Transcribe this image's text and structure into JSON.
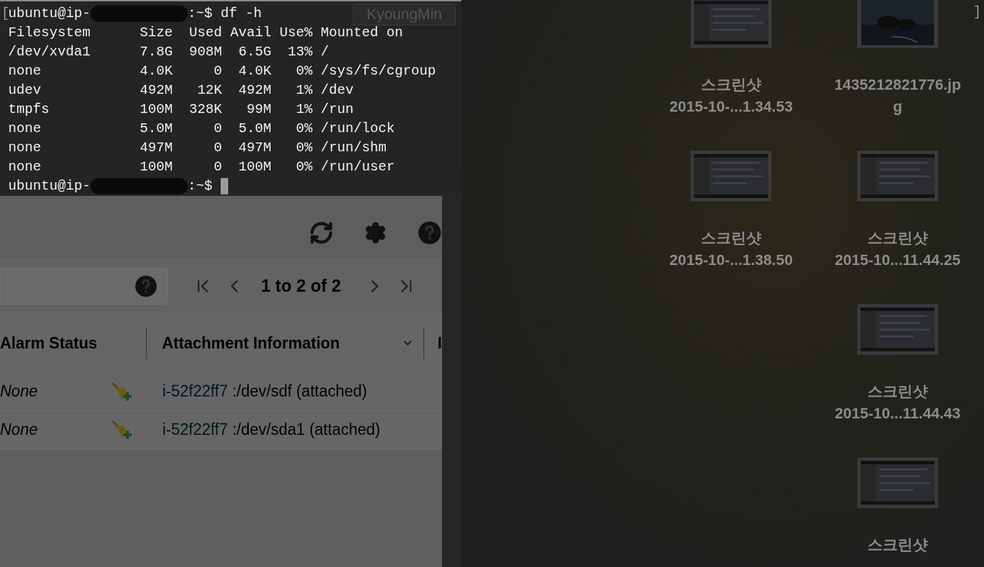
{
  "terminal": {
    "open_bracket": "[",
    "lines": [
      {
        "kind": "prompt",
        "user": "ubuntu@ip-",
        "suffix": ":~$",
        "command": "df -h",
        "cursor": false
      },
      {
        "kind": "output",
        "text": "Filesystem      Size  Used Avail Use% Mounted on"
      },
      {
        "kind": "output",
        "text": "/dev/xvda1      7.8G  908M  6.5G  13% /"
      },
      {
        "kind": "output",
        "text": "none            4.0K     0  4.0K   0% /sys/fs/cgroup"
      },
      {
        "kind": "output",
        "text": "udev            492M   12K  492M   1% /dev"
      },
      {
        "kind": "output",
        "text": "tmpfs           100M  328K   99M   1% /run"
      },
      {
        "kind": "output",
        "text": "none            5.0M     0  5.0M   0% /run/lock"
      },
      {
        "kind": "output",
        "text": "none            497M     0  497M   0% /run/shm"
      },
      {
        "kind": "output",
        "text": "none            100M     0  100M   0% /run/user"
      },
      {
        "kind": "prompt",
        "user": "ubuntu@ip-",
        "suffix": ":~$",
        "cursor": true
      }
    ]
  },
  "browser": {
    "tab_title": "KyoungMin",
    "pagination": {
      "text": "1 to 2 of 2"
    },
    "table": {
      "columns": [
        "Alarm Status",
        "Attachment Information",
        "I"
      ],
      "rows": [
        {
          "alarm_status": "None",
          "instance": "i-52f22ff7",
          "device": ":/dev/sdf (attached)"
        },
        {
          "alarm_status": "None",
          "instance": "i-52f22ff7",
          "device": ":/dev/sda1 (attached)"
        }
      ]
    }
  },
  "desktop": {
    "close_bracket": "]",
    "items": [
      {
        "name_lines": [
          "스크린샷",
          "2015-10-...1.34.53"
        ]
      },
      {
        "name_lines": [
          "1435212821776.jp",
          "g"
        ]
      },
      {
        "name_lines": [
          "스크린샷",
          "2015-10-...1.38.50"
        ]
      },
      {
        "name_lines": [
          "스크린샷",
          "2015-10...11.44.25"
        ]
      },
      {
        "name_lines": [
          "스크린샷",
          "2015-10...11.44.43"
        ]
      },
      {
        "name_lines": [
          "스크린샷"
        ]
      }
    ]
  }
}
